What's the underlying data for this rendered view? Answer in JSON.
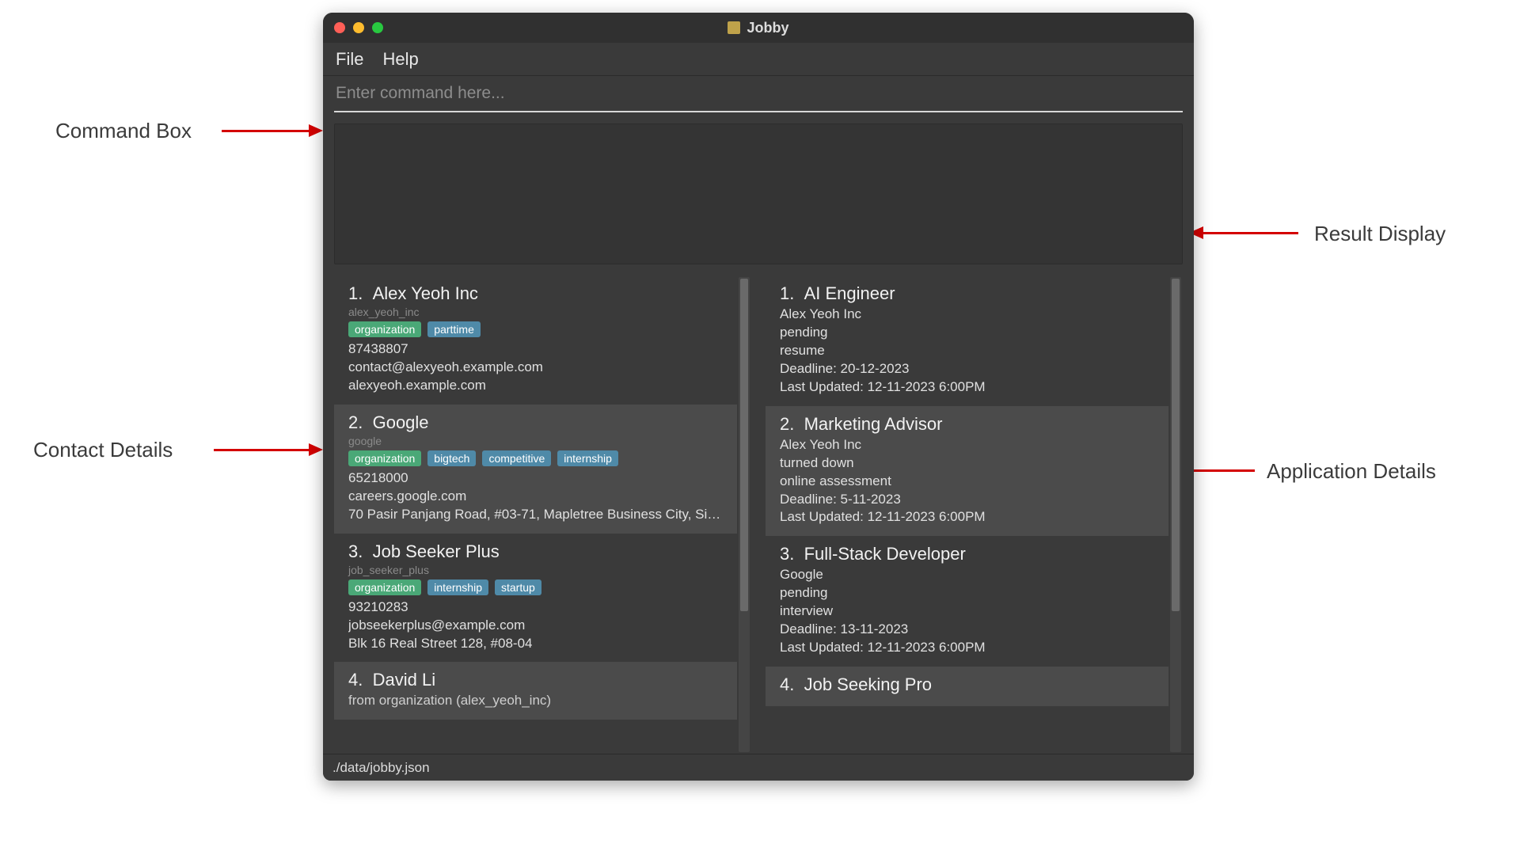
{
  "annotations": {
    "command_box": "Command Box",
    "result_display": "Result Display",
    "contact_details": "Contact Details",
    "application_details": "Application Details"
  },
  "window": {
    "title": "Jobby",
    "menu": {
      "file": "File",
      "help": "Help"
    },
    "command_placeholder": "Enter command here...",
    "status_path": "./data/jobby.json"
  },
  "contacts": [
    {
      "num": "1.",
      "name": "Alex Yeoh Inc",
      "id": "alex_yeoh_inc",
      "tags": [
        "organization",
        "parttime"
      ],
      "lines": [
        "87438807",
        "contact@alexyeoh.example.com",
        "alexyeoh.example.com"
      ]
    },
    {
      "num": "2.",
      "name": "Google",
      "id": "google",
      "tags": [
        "organization",
        "bigtech",
        "competitive",
        "internship"
      ],
      "lines": [
        "65218000",
        "careers.google.com",
        "70 Pasir Panjang Road, #03-71, Mapletree Business City, Sin..."
      ]
    },
    {
      "num": "3.",
      "name": "Job Seeker Plus",
      "id": "job_seeker_plus",
      "tags": [
        "organization",
        "internship",
        "startup"
      ],
      "lines": [
        "93210283",
        "jobseekerplus@example.com",
        "Blk 16 Real Street 128, #08-04"
      ]
    },
    {
      "num": "4.",
      "name": "David Li",
      "id": "",
      "tags": [],
      "lines": [
        "from organization (alex_yeoh_inc)"
      ]
    }
  ],
  "applications": [
    {
      "num": "1.",
      "title": "AI Engineer",
      "lines": [
        "Alex Yeoh Inc",
        "pending",
        "resume",
        "Deadline: 20-12-2023",
        "Last Updated: 12-11-2023 6:00PM"
      ]
    },
    {
      "num": "2.",
      "title": "Marketing Advisor",
      "lines": [
        "Alex Yeoh Inc",
        "turned down",
        "online assessment",
        "Deadline: 5-11-2023",
        "Last Updated: 12-11-2023 6:00PM"
      ]
    },
    {
      "num": "3.",
      "title": "Full-Stack Developer",
      "lines": [
        "Google",
        "pending",
        "interview",
        "Deadline: 13-11-2023",
        "Last Updated: 12-11-2023 6:00PM"
      ]
    },
    {
      "num": "4.",
      "title": "Job Seeking Pro",
      "lines": []
    }
  ]
}
